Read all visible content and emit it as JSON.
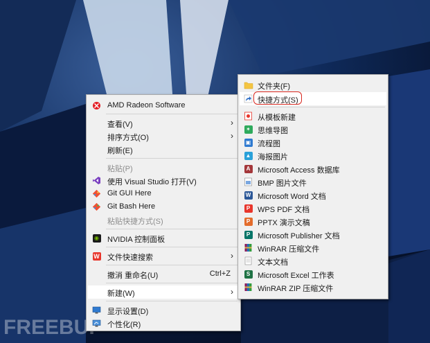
{
  "context_menu": {
    "items": [
      {
        "label": "AMD Radeon Software",
        "icon": "amd-icon"
      },
      {
        "label": "查看(V)",
        "icon": ""
      },
      {
        "label": "排序方式(O)",
        "icon": ""
      },
      {
        "label": "刷新(E)",
        "icon": ""
      },
      {
        "label": "粘贴(P)",
        "icon": ""
      },
      {
        "label": "使用 Visual Studio 打开(V)",
        "icon": "visual-studio-icon"
      },
      {
        "label": "Git GUI Here",
        "icon": "git-gui-icon"
      },
      {
        "label": "Git Bash Here",
        "icon": "git-bash-icon"
      },
      {
        "label": "粘贴快捷方式(S)",
        "icon": ""
      },
      {
        "label": "NVIDIA 控制面板",
        "icon": "nvidia-icon"
      },
      {
        "label": "文件快速搜索",
        "icon": "wps-search-icon"
      },
      {
        "label": "撤消 重命名(U)",
        "shortcut": "Ctrl+Z",
        "icon": ""
      },
      {
        "label": "新建(W)",
        "icon": ""
      },
      {
        "label": "显示设置(D)",
        "icon": "display-icon"
      },
      {
        "label": "个性化(R)",
        "icon": "personalize-icon"
      }
    ]
  },
  "new_submenu": {
    "items": [
      {
        "label": "文件夹(F)",
        "icon": "folder-icon"
      },
      {
        "label": "快捷方式(S)",
        "icon": "shortcut-icon"
      },
      {
        "label": "从模板新建",
        "icon": "template-icon"
      },
      {
        "label": "思维导图",
        "icon": "mindmap-icon"
      },
      {
        "label": "流程图",
        "icon": "flowchart-icon"
      },
      {
        "label": "海报图片",
        "icon": "poster-icon"
      },
      {
        "label": "Microsoft Access 数据库",
        "icon": "access-icon"
      },
      {
        "label": "BMP 图片文件",
        "icon": "bmp-icon"
      },
      {
        "label": "Microsoft Word 文档",
        "icon": "word-icon"
      },
      {
        "label": "WPS PDF 文档",
        "icon": "pdf-icon"
      },
      {
        "label": "PPTX 演示文稿",
        "icon": "pptx-icon"
      },
      {
        "label": "Microsoft Publisher 文档",
        "icon": "publisher-icon"
      },
      {
        "label": "WinRAR 压缩文件",
        "icon": "winrar-icon"
      },
      {
        "label": "文本文档",
        "icon": "text-icon"
      },
      {
        "label": "Microsoft Excel 工作表",
        "icon": "excel-icon"
      },
      {
        "label": "WinRAR ZIP 压缩文件",
        "icon": "winrar-zip-icon"
      }
    ]
  },
  "watermark": "FREEBUF",
  "colors": {
    "menu_bg": "#f0f0f0",
    "highlight_ring": "#d9281f",
    "disabled_text": "#8c8c8c"
  }
}
